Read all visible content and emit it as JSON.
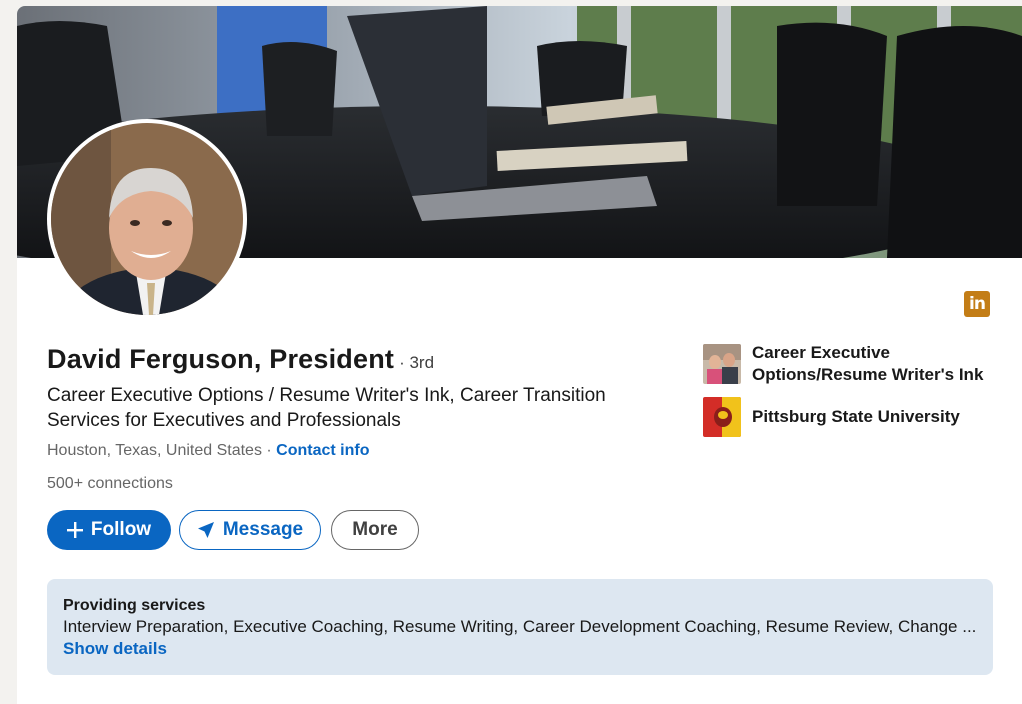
{
  "profile": {
    "name": "David Ferguson, President",
    "degree": "· 3rd",
    "headline": "Career Executive Options / Resume Writer's Ink, Career Transition Services for Executives and Professionals",
    "location": "Houston, Texas, United States ·",
    "contact_link": "Contact info",
    "connections": "500+ connections"
  },
  "actions": {
    "follow": "Follow",
    "message": "Message",
    "more": "More"
  },
  "organizations": [
    {
      "name": "Career Executive Options/Resume Writer's Ink",
      "icon": "company-photo-logo"
    },
    {
      "name": "Pittsburg State University",
      "icon": "university-gorilla-logo"
    }
  ],
  "badge": {
    "icon": "linkedin-icon",
    "text": "in",
    "color": "#c37d16"
  },
  "services": {
    "title": "Providing services",
    "list": "Interview Preparation, Executive Coaching, Resume Writing, Career Development Coaching, Resume Review, Change ...",
    "link": "Show details"
  },
  "colors": {
    "accent": "#0a66c2",
    "services_bg": "#dde7f1",
    "badge": "#c37d16"
  }
}
